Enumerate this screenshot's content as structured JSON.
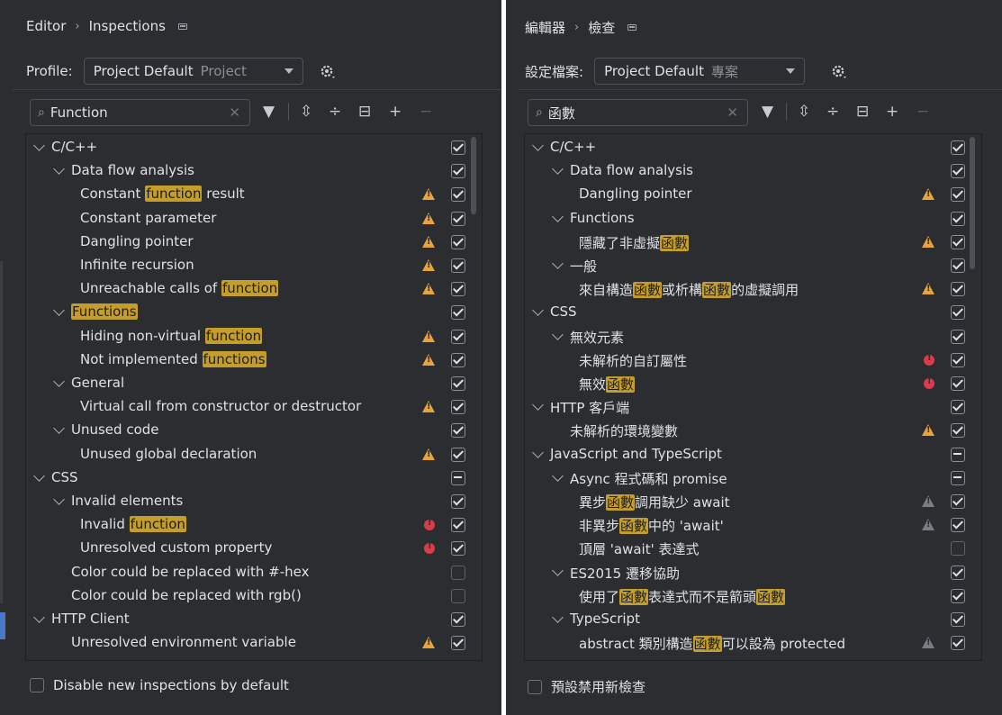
{
  "left": {
    "breadcrumb": [
      "Editor",
      "Inspections"
    ],
    "profile_label": "Profile:",
    "profile_value": "Project Default",
    "profile_scope": "Project",
    "search_value": "Function",
    "footer_label": "Disable new inspections by default",
    "rows": [
      {
        "text": "C/C++",
        "hl": "",
        "pre": "",
        "post": "",
        "level": 0,
        "chevron": true,
        "icon": "",
        "check": "checked"
      },
      {
        "text": "Data flow analysis",
        "level": 1,
        "chevron": true,
        "icon": "",
        "check": "checked"
      },
      {
        "pre": "Constant ",
        "hl": "function",
        "post": " result",
        "level": 2,
        "icon": "warn",
        "check": "checked"
      },
      {
        "text": "Constant parameter",
        "level": 2,
        "icon": "warn",
        "check": "checked"
      },
      {
        "text": "Dangling pointer",
        "level": 2,
        "icon": "warn",
        "check": "checked"
      },
      {
        "text": "Infinite recursion",
        "level": 2,
        "icon": "warn",
        "check": "checked"
      },
      {
        "pre": "Unreachable calls of ",
        "hl": "function",
        "post": "",
        "level": 2,
        "icon": "warn",
        "check": "checked"
      },
      {
        "pre": "",
        "hl": "Functions",
        "post": "",
        "level": 1,
        "chevron": true,
        "icon": "",
        "check": "checked"
      },
      {
        "pre": "Hiding non-virtual ",
        "hl": "function",
        "post": "",
        "level": 2,
        "icon": "warn",
        "check": "checked"
      },
      {
        "pre": "Not implemented ",
        "hl": "functions",
        "post": "",
        "level": 2,
        "icon": "warn",
        "check": "checked"
      },
      {
        "text": "General",
        "level": 1,
        "chevron": true,
        "icon": "",
        "check": "checked"
      },
      {
        "text": "Virtual call from constructor or destructor",
        "level": 2,
        "icon": "warn",
        "check": "checked"
      },
      {
        "text": "Unused code",
        "level": 1,
        "chevron": true,
        "icon": "",
        "check": "checked"
      },
      {
        "text": "Unused global declaration",
        "level": 2,
        "icon": "warn",
        "check": "checked"
      },
      {
        "text": "CSS",
        "level": 0,
        "chevron": true,
        "icon": "",
        "check": "mixed"
      },
      {
        "text": "Invalid elements",
        "level": 1,
        "chevron": true,
        "icon": "",
        "check": "checked"
      },
      {
        "pre": "Invalid ",
        "hl": "function",
        "post": "",
        "level": 2,
        "icon": "err",
        "check": "checked"
      },
      {
        "text": "Unresolved custom property",
        "level": 2,
        "icon": "err",
        "check": "checked"
      },
      {
        "text": "Color could be replaced with #-hex",
        "level": 1,
        "icon": "",
        "check": "empty"
      },
      {
        "text": "Color could be replaced with rgb()",
        "level": 1,
        "icon": "",
        "check": "empty"
      },
      {
        "text": "HTTP Client",
        "level": 0,
        "chevron": true,
        "icon": "",
        "check": "checked"
      },
      {
        "text": "Unresolved environment variable",
        "level": 1,
        "icon": "warn",
        "check": "checked"
      }
    ]
  },
  "right": {
    "breadcrumb": [
      "編輯器",
      "檢查"
    ],
    "profile_label": "設定檔案:",
    "profile_value": "Project Default",
    "profile_scope": "專案",
    "search_value": "函數",
    "footer_label": "預設禁用新檢查",
    "rows": [
      {
        "text": "C/C++",
        "level": 0,
        "chevron": true,
        "icon": "",
        "check": "checked"
      },
      {
        "text": "Data flow analysis",
        "level": 1,
        "chevron": true,
        "icon": "",
        "check": "checked"
      },
      {
        "text": "Dangling pointer",
        "level": 2,
        "icon": "warn",
        "check": "checked"
      },
      {
        "text": "Functions",
        "level": 1,
        "chevron": true,
        "icon": "",
        "check": "checked"
      },
      {
        "pre": "隱藏了非虛擬",
        "hl": "函數",
        "post": "",
        "level": 2,
        "icon": "warn",
        "check": "checked"
      },
      {
        "text": "一般",
        "level": 1,
        "chevron": true,
        "icon": "",
        "check": "checked"
      },
      {
        "segments": [
          "來自構造",
          "函數",
          "或析構",
          "函數",
          "的虛擬調用"
        ],
        "level": 2,
        "icon": "warn",
        "check": "checked"
      },
      {
        "text": "CSS",
        "level": 0,
        "chevron": true,
        "icon": "",
        "check": "checked"
      },
      {
        "text": "無效元素",
        "level": 1,
        "chevron": true,
        "icon": "",
        "check": "checked"
      },
      {
        "text": "未解析的自訂屬性",
        "level": 2,
        "icon": "err",
        "check": "checked"
      },
      {
        "pre": "無效",
        "hl": "函數",
        "post": "",
        "level": 2,
        "icon": "err",
        "check": "checked"
      },
      {
        "text": "HTTP 客戶端",
        "level": 0,
        "chevron": true,
        "icon": "",
        "check": "checked"
      },
      {
        "text": "未解析的環境變數",
        "level": 1,
        "icon": "warn",
        "check": "checked"
      },
      {
        "text": "JavaScript and TypeScript",
        "level": 0,
        "chevron": true,
        "icon": "",
        "check": "mixed"
      },
      {
        "text": "Async 程式碼和 promise",
        "level": 1,
        "chevron": true,
        "icon": "",
        "check": "mixed"
      },
      {
        "pre": "異步",
        "hl": "函數",
        "post": "調用缺少 await",
        "level": 2,
        "icon": "warn-gray",
        "check": "checked"
      },
      {
        "pre": "非異步",
        "hl": "函數",
        "post": "中的 'await'",
        "level": 2,
        "icon": "warn-gray",
        "check": "checked"
      },
      {
        "text": "頂層 'await' 表達式",
        "level": 2,
        "icon": "",
        "check": "empty"
      },
      {
        "text": "ES2015 遷移協助",
        "level": 1,
        "chevron": true,
        "icon": "",
        "check": "checked"
      },
      {
        "segments": [
          "使用了",
          "函數",
          "表達式而不是箭頭",
          "函數"
        ],
        "level": 2,
        "icon": "",
        "check": "checked"
      },
      {
        "text": "TypeScript",
        "level": 1,
        "chevron": true,
        "icon": "",
        "check": "checked"
      },
      {
        "pre": "abstract 類別構造",
        "hl": "函數",
        "post": "可以設為 protected",
        "level": 2,
        "icon": "warn-gray",
        "check": "checked"
      }
    ]
  }
}
